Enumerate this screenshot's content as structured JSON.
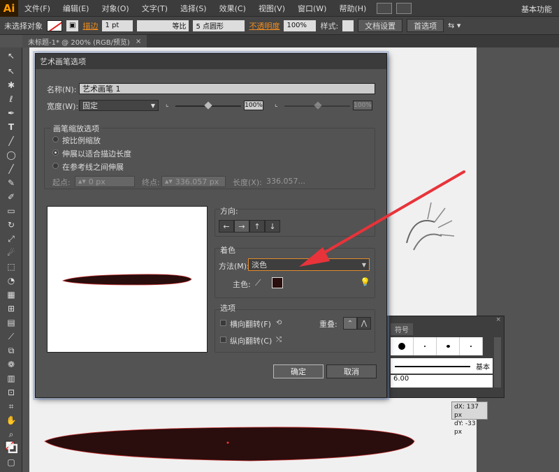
{
  "app": {
    "logo": "Ai",
    "workspace": "基本功能"
  },
  "menu": [
    "文件(F)",
    "编辑(E)",
    "对象(O)",
    "文字(T)",
    "选择(S)",
    "效果(C)",
    "视图(V)",
    "窗口(W)",
    "帮助(H)"
  ],
  "controlbar": {
    "selection": "未选择对象",
    "stroke_label": "描边",
    "stroke_weight": "1 pt",
    "profile": "等比",
    "brush": "5 点圆形",
    "opacity_label": "不透明度",
    "opacity": "100%",
    "style_label": "样式:",
    "doc_settings": "文档设置",
    "preferences": "首选项"
  },
  "document_tab": "未标题-1* @ 200% (RGB/预览)",
  "dialog": {
    "title": "艺术画笔选项",
    "name_label": "名称(N):",
    "name_value": "艺术画笔 1",
    "width_label": "宽度(W):",
    "width_value": "固定",
    "width_pct1": "100%",
    "width_pct2": "100%",
    "scale_group": "画笔缩放选项",
    "scale_options": [
      "按比例缩放",
      "伸展以适合描边长度",
      "在参考线之间伸展"
    ],
    "scale_selected": 1,
    "start_label": "起点:",
    "start_value": "0 px",
    "end_label": "终点:",
    "end_value": "336.057 px",
    "length_label": "长度(X):",
    "length_value": "336.057...",
    "direction_group": "方向:",
    "direction_buttons": [
      "←",
      "→",
      "↑",
      "↓"
    ],
    "direction_selected": 1,
    "colorization_group": "着色",
    "method_label": "方法(M):",
    "method_value": "淡色",
    "key_color_label": "主色:",
    "key_color": "#2a0d0d",
    "options_group": "选项",
    "flip_along": "横向翻转(F)",
    "flip_across": "纵向翻转(C)",
    "overlap_label": "重叠:",
    "ok": "确定",
    "cancel": "取消"
  },
  "brushes_panel": {
    "tab": "符号",
    "basic": "基本",
    "partial_value": "6.00"
  },
  "delta_tip": {
    "dx": "dX: 137 px",
    "dy": "dY: -33 px"
  },
  "colors": {
    "accent_orange": "#f08c1e",
    "arrow_red": "#e8333a",
    "stroke_dark": "#2a0d0d"
  }
}
